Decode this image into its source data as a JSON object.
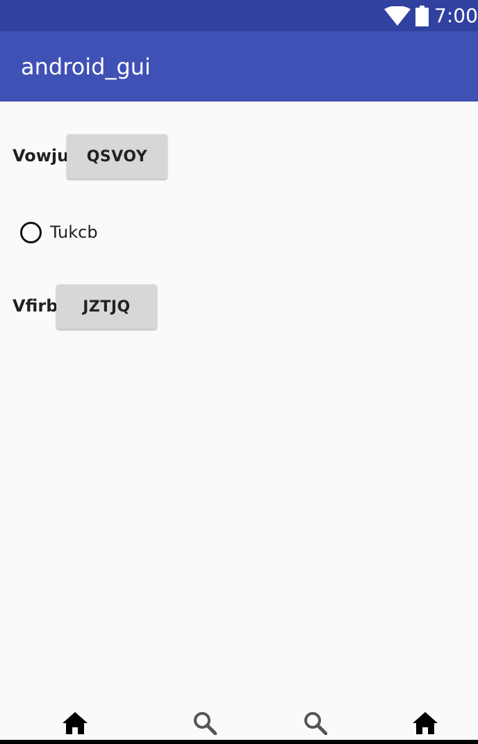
{
  "status_bar": {
    "time": "7:00",
    "icons": [
      "wifi-icon",
      "battery-icon"
    ],
    "background": "#3141a0"
  },
  "app_bar": {
    "title": "android_gui",
    "background": "#3f51b5"
  },
  "rows": [
    {
      "label": "Vowju",
      "button_label": "QSVOY"
    },
    {
      "radio_label": "Tukcb",
      "checked": false
    },
    {
      "label": "Vfirb",
      "button_label": "JZTJQ"
    }
  ],
  "bottom_nav": {
    "items": [
      {
        "icon": "home-icon"
      },
      {
        "icon": "search-icon"
      },
      {
        "icon": "search-icon"
      },
      {
        "icon": "home-icon"
      }
    ]
  },
  "colors": {
    "content_background": "#fafafa",
    "button_background": "#d6d7d7",
    "text": "#212121"
  }
}
